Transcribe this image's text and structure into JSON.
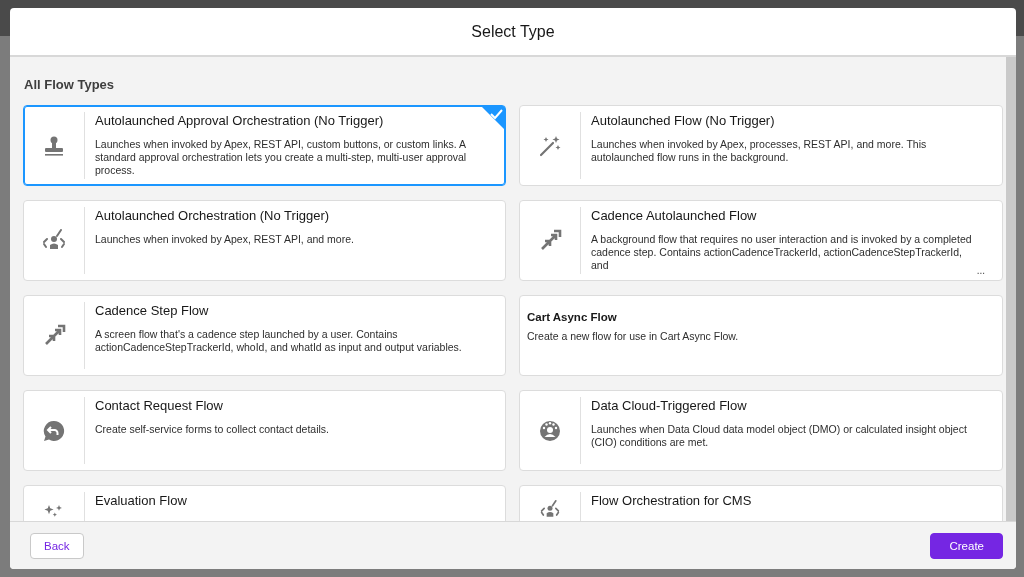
{
  "modal": {
    "title": "Select Type"
  },
  "section": {
    "heading": "All Flow Types"
  },
  "flow_types": [
    {
      "kind": "icon",
      "title": "Autolaunched Approval Orchestration (No Trigger)",
      "description": "Launches when invoked by Apex, REST API, custom buttons, or custom links. A standard approval orchestration lets you create a multi-step, multi-user approval process.",
      "selected": true
    },
    {
      "kind": "icon",
      "title": "Autolaunched Flow (No Trigger)",
      "description": "Launches when invoked by Apex, processes, REST API, and more. This autolaunched flow runs in the background.",
      "selected": false
    },
    {
      "kind": "icon",
      "title": "Autolaunched Orchestration (No Trigger)",
      "description": "Launches when invoked by Apex, REST API, and more.",
      "selected": false
    },
    {
      "kind": "icon",
      "title": "Cadence Autolaunched Flow",
      "description": "A background flow that requires no user interaction and is invoked by a completed cadence step. Contains actionCadenceTrackerId, actionCadenceStepTrackerId, and",
      "more": "...",
      "selected": false
    },
    {
      "kind": "icon",
      "title": "Cadence Step Flow",
      "description": "A screen flow that's a cadence step launched by a user. Contains actionCadenceStepTrackerId, whoId, and whatId as input and output variables.",
      "selected": false
    },
    {
      "kind": "plain",
      "title": "Cart Async Flow",
      "description": "Create a new flow for use in Cart Async Flow.",
      "selected": false
    },
    {
      "kind": "icon",
      "title": "Contact Request Flow",
      "description": "Create self-service forms to collect contact details.",
      "selected": false
    },
    {
      "kind": "icon",
      "title": "Data Cloud-Triggered Flow",
      "description": "Launches when Data Cloud data model object (DMO) or calculated insight object (CIO) conditions are met.",
      "selected": false
    },
    {
      "kind": "icon",
      "title": "Evaluation Flow",
      "selected": false
    },
    {
      "kind": "icon",
      "title": "Flow Orchestration for CMS",
      "selected": false
    }
  ],
  "footer": {
    "back": "Back",
    "create": "Create"
  }
}
